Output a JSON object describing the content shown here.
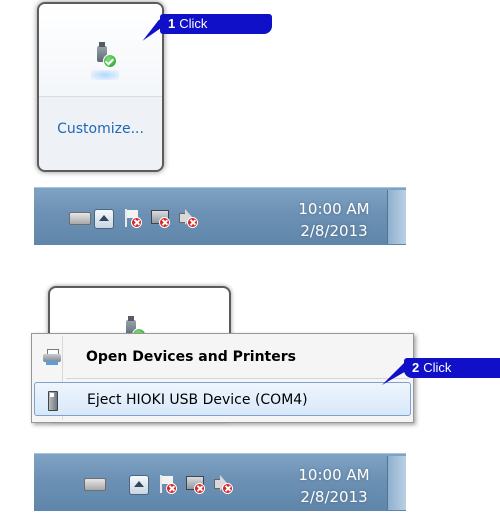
{
  "panel1": {
    "flyout": {
      "customize_label": "Customize..."
    },
    "callout": {
      "number": "1",
      "text": "Click"
    },
    "taskbar": {
      "time": "10:00 AM",
      "date": "2/8/2013"
    }
  },
  "panel2": {
    "context_menu": {
      "items": [
        {
          "label": "Open Devices and Printers",
          "icon": "printer-icon"
        },
        {
          "label": "Eject HIOKI USB Device (COM4)",
          "icon": "usb-stick-icon"
        }
      ]
    },
    "callout": {
      "number": "2",
      "text": "Click"
    },
    "taskbar": {
      "time": "10:00 AM",
      "date": "2/8/2013"
    }
  },
  "colors": {
    "callout_bg": "#1010c8",
    "taskbar": "#6c91b4",
    "link_blue": "#1e66b8",
    "menu_highlight": "#d8e8fa"
  }
}
